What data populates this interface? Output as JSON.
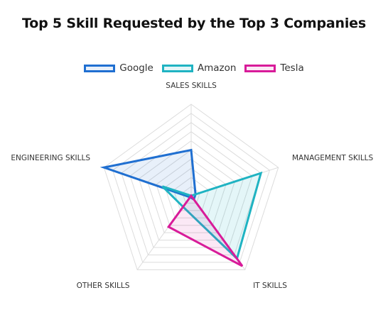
{
  "title": "Top 5 Skill Requested by the Top 3 Companies",
  "chart_data": {
    "type": "radar",
    "title": "Top 5 Skill Requested by the Top 3 Companies",
    "categories": [
      "SALES SKILLS",
      "MANAGEMENT SKILLS",
      "IT SKILLS",
      "OTHER SKILLS",
      "ENGINEERING SKILLS"
    ],
    "rlim": [
      0,
      10
    ],
    "grid_rings": 10,
    "grid": true,
    "legend_position": "top",
    "series": [
      {
        "name": "Google",
        "color": "#1f6fd1",
        "fill": "rgba(31,111,209,0.10)",
        "values": [
          5,
          0.5,
          0.5,
          0.2,
          10
        ]
      },
      {
        "name": "Amazon",
        "color": "#1fb3c2",
        "fill": "rgba(31,179,194,0.12)",
        "values": [
          0,
          8,
          8.5,
          1.5,
          3.3
        ]
      },
      {
        "name": "Tesla",
        "color": "#d81b99",
        "fill": "rgba(216,27,153,0.10)",
        "values": [
          0,
          0,
          9.5,
          4.2,
          0
        ]
      }
    ]
  }
}
